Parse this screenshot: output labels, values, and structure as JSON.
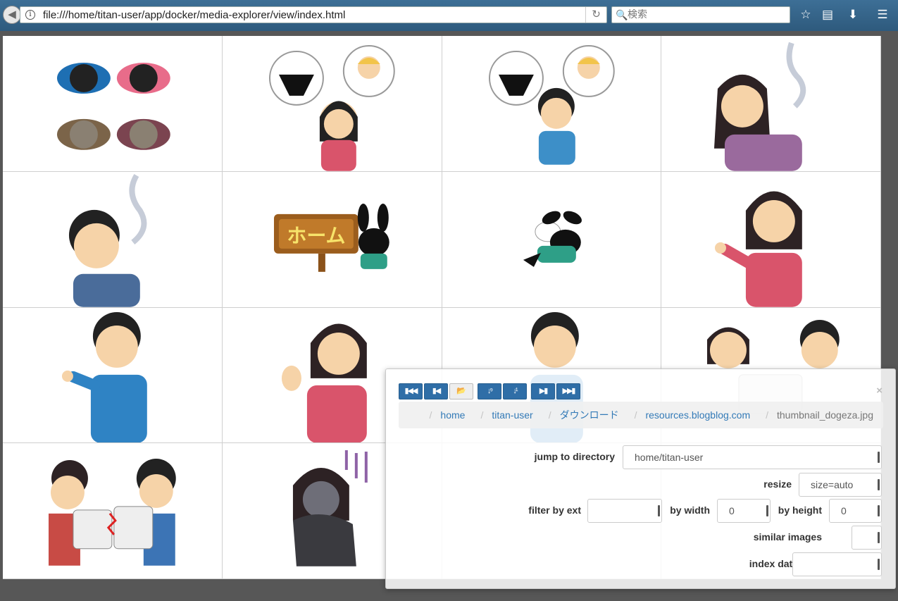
{
  "browser": {
    "url": "file:///home/titan-user/app/docker/media-explorer/view/index.html",
    "search_placeholder": "検索"
  },
  "gallery": {
    "items": [
      {
        "name": "people-bowing-top-view"
      },
      {
        "name": "woman-devil-angel-dilemma"
      },
      {
        "name": "man-devil-angel-dilemma"
      },
      {
        "name": "woman-soul-leaving"
      },
      {
        "name": "man-soul-leaving"
      },
      {
        "name": "home-sign-rabbit"
      },
      {
        "name": "flying-rabbit"
      },
      {
        "name": "woman-pointing"
      },
      {
        "name": "man-pointing"
      },
      {
        "name": "woman-raising-hand"
      },
      {
        "name": "man-thumbnail"
      },
      {
        "name": "couple-puzzle"
      },
      {
        "name": "couple-broken-puzzle"
      },
      {
        "name": "woman-depressed-sitting"
      }
    ]
  },
  "panel": {
    "close": "×",
    "nav_buttons": [
      {
        "name": "first",
        "glyph": "⏮"
      },
      {
        "name": "previous",
        "glyph": "⏴"
      },
      {
        "name": "folder",
        "glyph": "📂"
      },
      {
        "name": "sort-asc",
        "glyph": "↓⁹"
      },
      {
        "name": "sort-desc",
        "glyph": "↓¹"
      },
      {
        "name": "next",
        "glyph": "⏵"
      },
      {
        "name": "last",
        "glyph": "⏭"
      }
    ],
    "breadcrumb": {
      "home": "home",
      "user": "titan-user",
      "download": "ダウンロード",
      "site": "resources.blogblog.com",
      "file": "thumbnail_dogeza.jpg"
    },
    "form": {
      "jump_label": "jump to directory",
      "jump_value": "home/titan-user",
      "resize_label": "resize",
      "resize_value": "size=auto",
      "filter_label": "filter by ext",
      "filter_value": "",
      "width_label": "by width",
      "width_value": "0",
      "height_label": "by height",
      "height_value": "0",
      "similar_label": "similar images",
      "similar_value": "",
      "index_label": "index data",
      "index_value": ""
    }
  },
  "colors": {
    "primary_button": "#2f6ea7",
    "link": "#337ab7",
    "toolbar": "#3d6f96"
  }
}
